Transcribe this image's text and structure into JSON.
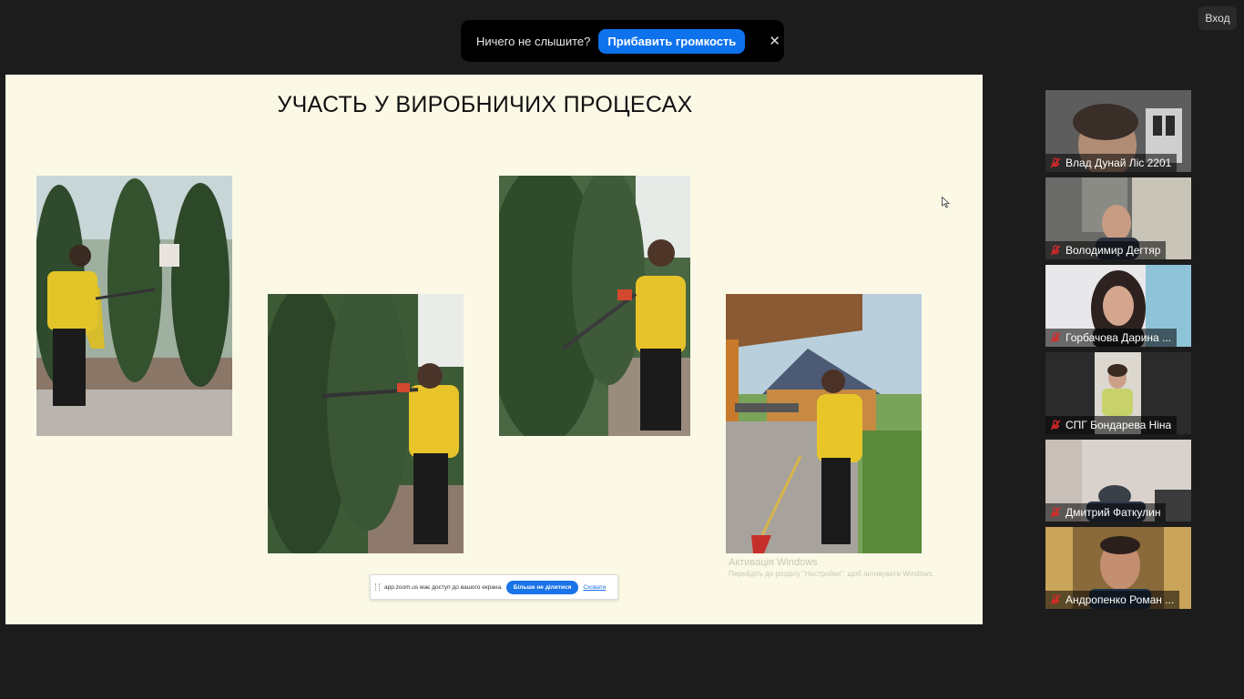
{
  "notification": {
    "text": "Ничего не слышите?",
    "button_label": "Прибавить громкость",
    "close_glyph": "✕"
  },
  "login_label": "Вход",
  "slide": {
    "title": "УЧАСТЬ У ВИРОБНИЧИХ ПРОЦЕСАХ",
    "windows_activation": {
      "title": "Активація Windows",
      "subtitle": "Перейдіть до розділу \"Настройки\", щоб активувати Windows."
    },
    "share_bar": {
      "text": "app.zoom.us має доступ до вашого екрана.",
      "stop_label": "Більше не ділитися",
      "hide_label": "Сховати"
    }
  },
  "participants": [
    {
      "name": "Влад Дунай Ліс 2201",
      "muted": true
    },
    {
      "name": "Володимир Дегтяр",
      "muted": true
    },
    {
      "name": "Горбачова Дарина ...",
      "muted": true
    },
    {
      "name": "СПГ Бондарева Ніна",
      "muted": true
    },
    {
      "name": "Дмитрий Фаткулин",
      "muted": true
    },
    {
      "name": "Андропенко Роман ...",
      "muted": true
    }
  ],
  "colors": {
    "accent": "#0e72ed",
    "slide_bg": "#fbf9e6",
    "app_bg": "#1c1c1c",
    "muted_icon": "#e02828"
  }
}
